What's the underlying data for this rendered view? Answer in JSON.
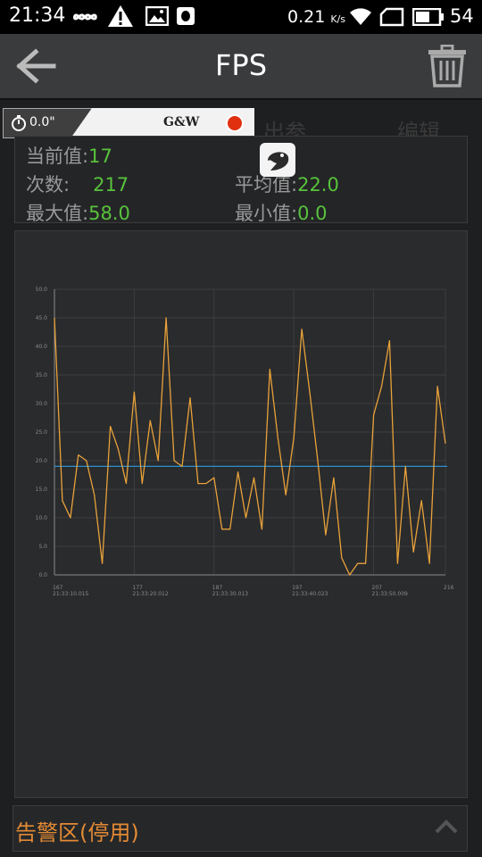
{
  "status_bar": {
    "time": "21:34",
    "speed": "0.21",
    "speed_unit": "K/s",
    "battery": "54"
  },
  "app_bar": {
    "title": "FPS",
    "back_icon": "back-arrow-icon",
    "delete_icon": "trash-icon"
  },
  "background_tabs": {
    "tab1": "出参",
    "tab2": "编辑"
  },
  "gw_overlay": {
    "timer_value": "0.0\"",
    "brand": "G&W",
    "record_color": "#e03010"
  },
  "stats": {
    "current_label": "当前值:",
    "current_value": "17",
    "count_label": "次数:",
    "count_value": "217",
    "avg_label": "平均值:",
    "avg_value": "22.0",
    "max_label": "最大值:",
    "max_value": "58.0",
    "min_label": "最小值:",
    "min_value": "0.0"
  },
  "chart_data": {
    "type": "line",
    "title": "",
    "xlabel": "",
    "ylabel": "",
    "ylim": [
      0,
      50
    ],
    "yticks": [
      "0.0",
      "5.0",
      "10.0",
      "15.0",
      "20.0",
      "25.0",
      "30.0",
      "35.0",
      "40.0",
      "45.0",
      "50.0"
    ],
    "xlim": [
      167,
      216
    ],
    "xticks": [
      {
        "x": 167,
        "label": "167",
        "sub": "21:33:10.015"
      },
      {
        "x": 177,
        "label": "177",
        "sub": "21:33:20.012"
      },
      {
        "x": 187,
        "label": "187",
        "sub": "21:33:30.013"
      },
      {
        "x": 197,
        "label": "197",
        "sub": "21:33:40.023"
      },
      {
        "x": 207,
        "label": "207",
        "sub": "21:33:50.009"
      },
      {
        "x": 216,
        "label": "216",
        "sub": ""
      }
    ],
    "grid": true,
    "series": [
      {
        "color": "#e8a23a",
        "x": [
          167,
          168,
          169,
          170,
          171,
          172,
          173,
          174,
          175,
          176,
          177,
          178,
          179,
          180,
          181,
          182,
          183,
          184,
          185,
          186,
          187,
          188,
          189,
          190,
          191,
          192,
          193,
          194,
          195,
          196,
          197,
          198,
          199,
          200,
          201,
          202,
          203,
          204,
          205,
          206,
          207,
          208,
          209,
          210,
          211,
          212,
          213,
          214,
          215,
          216
        ],
        "values": [
          45,
          13,
          10,
          21,
          20,
          14,
          2,
          26,
          22,
          16,
          32,
          16,
          27,
          20,
          45,
          20,
          19,
          31,
          16,
          16,
          17,
          8,
          8,
          18,
          10,
          17,
          8,
          36,
          24,
          14,
          24,
          43,
          32,
          20,
          7,
          17,
          3,
          0,
          2,
          2,
          28,
          33,
          41,
          2,
          19,
          4,
          13,
          2,
          33,
          23
        ]
      }
    ],
    "reference_line": {
      "value": 19,
      "color": "#2a8fd0"
    }
  },
  "alarm": {
    "label": "告警区(停用)"
  },
  "colors": {
    "accent_green": "#58c23c",
    "alarm_orange": "#e38a34",
    "line_orange": "#e8a23a",
    "ref_blue": "#2a8fd0"
  }
}
